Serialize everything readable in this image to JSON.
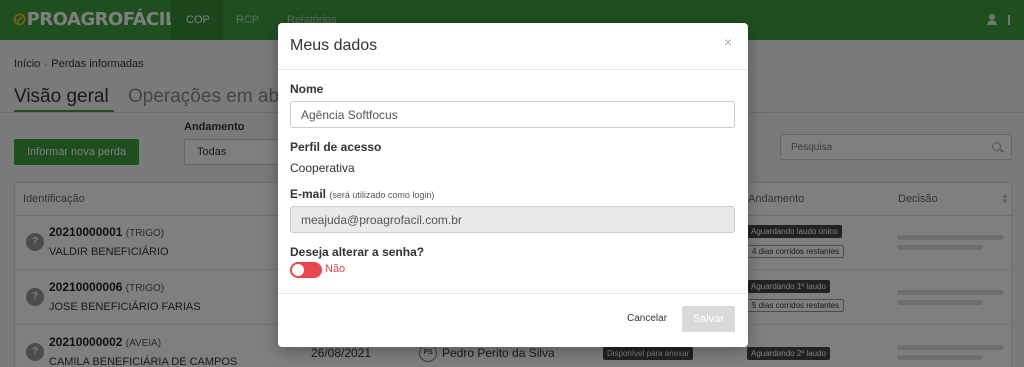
{
  "app": {
    "logo_text": "PROAGROFÁCIL",
    "nav": [
      "COP",
      "RCP",
      "Relatórios"
    ]
  },
  "breadcrumb": [
    "Início",
    "Perdas informadas"
  ],
  "tabs": [
    "Visão geral",
    "Operações em abe"
  ],
  "toolbar": {
    "new_button": "Informar nova perda",
    "filter_label": "Andamento",
    "filter_value": "Todas",
    "search_placeholder": "Pesquisa"
  },
  "table": {
    "headers": {
      "identificacao": "Identificação",
      "andamento": "Andamento",
      "decisao": "Decisão"
    },
    "rows": [
      {
        "id": "20210000001",
        "crop": "(TRIGO)",
        "name": "VALDIR BENEFICIÁRIO",
        "status": "Aguardando laudo único",
        "days": "4 dias corridos restantes"
      },
      {
        "id": "20210000006",
        "crop": "(TRIGO)",
        "name": "JOSE BENEFICIÁRIO FARIAS",
        "status": "Aguardando 1º laudo",
        "days": "5 dias corridos restantes"
      },
      {
        "id": "20210000002",
        "crop": "(AVEIA)",
        "name": "CAMILA BENEFICIÁRIA DE CAMPOS",
        "date": "26/08/2021",
        "perito_initials": "PS",
        "perito": "Pedro Perito da Silva",
        "anexo": "Disponível para anexar",
        "status": "Aguardando 2º laudo"
      }
    ]
  },
  "modal": {
    "title": "Meus dados",
    "close": "×",
    "nome_label": "Nome",
    "nome_value": "Agência Softfocus",
    "perfil_label": "Perfil de acesso",
    "perfil_value": "Cooperativa",
    "email_label": "E-mail",
    "email_hint": "(será utilizado como login)",
    "email_value": "meajuda@proagrofacil.com.br",
    "senha_label": "Deseja alterar a senha?",
    "senha_toggle_text": "Não",
    "cancel": "Cancelar",
    "save": "Salvar"
  },
  "colors": {
    "brand_green": "#3f9e3f",
    "toggle_red": "#e8474b"
  }
}
